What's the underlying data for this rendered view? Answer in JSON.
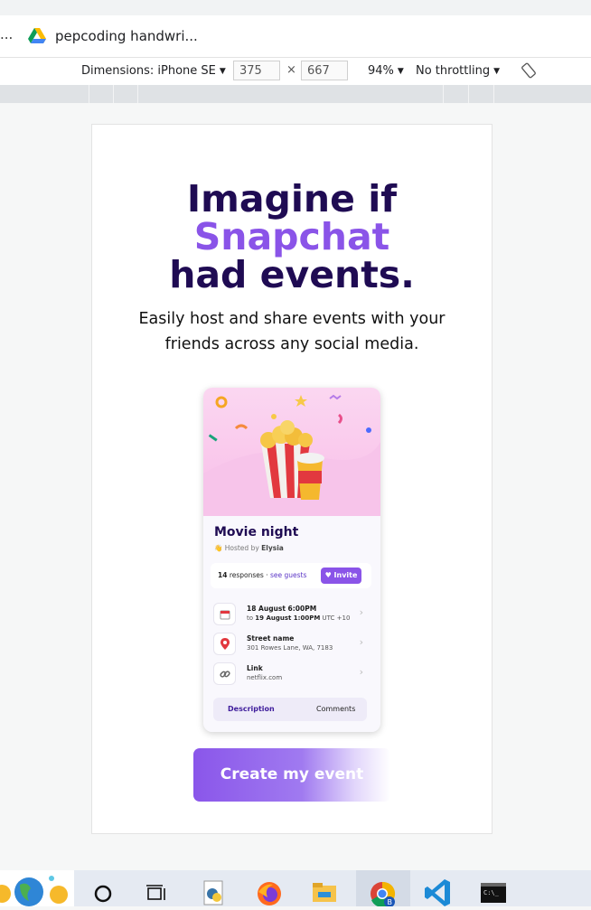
{
  "browser": {
    "tab_ellipsis": "...",
    "tab_title": "pepcoding handwri...",
    "device_label": "Dimensions: iPhone SE",
    "width": "375",
    "dim_separator": "×",
    "height": "667",
    "zoom": "94%",
    "throttling": "No throttling"
  },
  "hero": {
    "line1": "Imagine if",
    "line2": "Snapchat",
    "line3": "had events.",
    "accent_color": "#8a54e8",
    "title_color": "#1f0b53"
  },
  "subtitle_line1": "Easily host and share events with your",
  "subtitle_line2": "friends across any social media.",
  "card": {
    "title": "Movie night",
    "hosted_prefix": "Hosted by",
    "host": "Elysia",
    "responses_count": "14",
    "responses_label": "responses ·",
    "see_guests": "see guests",
    "invite": "Invite",
    "rows": [
      {
        "icon": "calendar-icon",
        "main": "18 August 6:00PM",
        "sub_prefix": "to",
        "sub_bold": "19 August 1:00PM",
        "sub_suffix": "UTC +10"
      },
      {
        "icon": "pin-icon",
        "main": "Street name",
        "sub": "301 Rowes Lane, WA, 7183"
      },
      {
        "icon": "link-icon",
        "main": "Link",
        "sub": "netflix.com"
      }
    ],
    "tab_description": "Description",
    "tab_comments": "Comments"
  },
  "cta_label": "Create my event"
}
